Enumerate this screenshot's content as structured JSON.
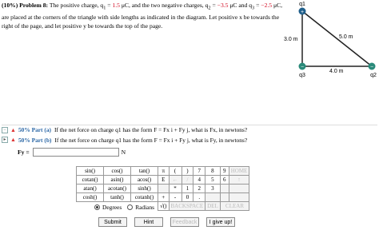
{
  "problem": {
    "header": "(10%) Problem 8:",
    "t1": "The positive charge, q",
    "s1": "1",
    "t2": " =",
    "q1": "1.5",
    "t3": " μC, and the two negative charges, q",
    "s2": "2",
    "t4": " =",
    "q2": "−3.5",
    "t5": " μC and q",
    "s3": "3",
    "t6": " =",
    "q3": "−2.5",
    "t7": " μC, are placed at the corners of the triangle with side lengths as indicated in the diagram. Let positive x be towards the right of the page, and let positive y be towards the top of the page."
  },
  "diagram": {
    "label_q1": "q1",
    "label_q2": "q2",
    "label_q3": "q3",
    "side_vertical": "3.0 m",
    "side_hyp": "5.0 m",
    "side_bottom": "4.0 m"
  },
  "part_a": {
    "label": "50% Part (a)",
    "text": "If the net force on charge q1 has the form F = Fx i + Fy j, what is Fx, in newtons?"
  },
  "part_b": {
    "label": "50% Part (b)",
    "text": "If the net force on charge q1 has the form F = Fx i + Fy j, what is Fy, in newtons?"
  },
  "answer": {
    "label": "Fy =",
    "unit": "N",
    "value": ""
  },
  "calc": {
    "rows": [
      [
        "sin()",
        "cos()",
        "tan()",
        "π",
        "(",
        ")",
        "7",
        "8",
        "9",
        "HOME"
      ],
      [
        "cotan()",
        "asin()",
        "acos()",
        "E",
        "←",
        "/",
        "4",
        "5",
        "6",
        "↑"
      ],
      [
        "atan()",
        "acotan()",
        "sinh()",
        "",
        "*",
        "1",
        "2",
        "3",
        "",
        ""
      ],
      [
        "cosh()",
        "tanh()",
        "cotanh()",
        "+",
        "-",
        "0",
        ".",
        "",
        "",
        ""
      ]
    ],
    "row5": [
      "√()",
      "BACKSPACE",
      "DEL",
      "CLEAR"
    ]
  },
  "radios": {
    "degrees": "Degrees",
    "radians": "Radians",
    "selected": "Degrees"
  },
  "buttons": {
    "submit": "Submit",
    "hint": "Hint",
    "feedback": "Feedback",
    "give_up": "I give up!"
  }
}
